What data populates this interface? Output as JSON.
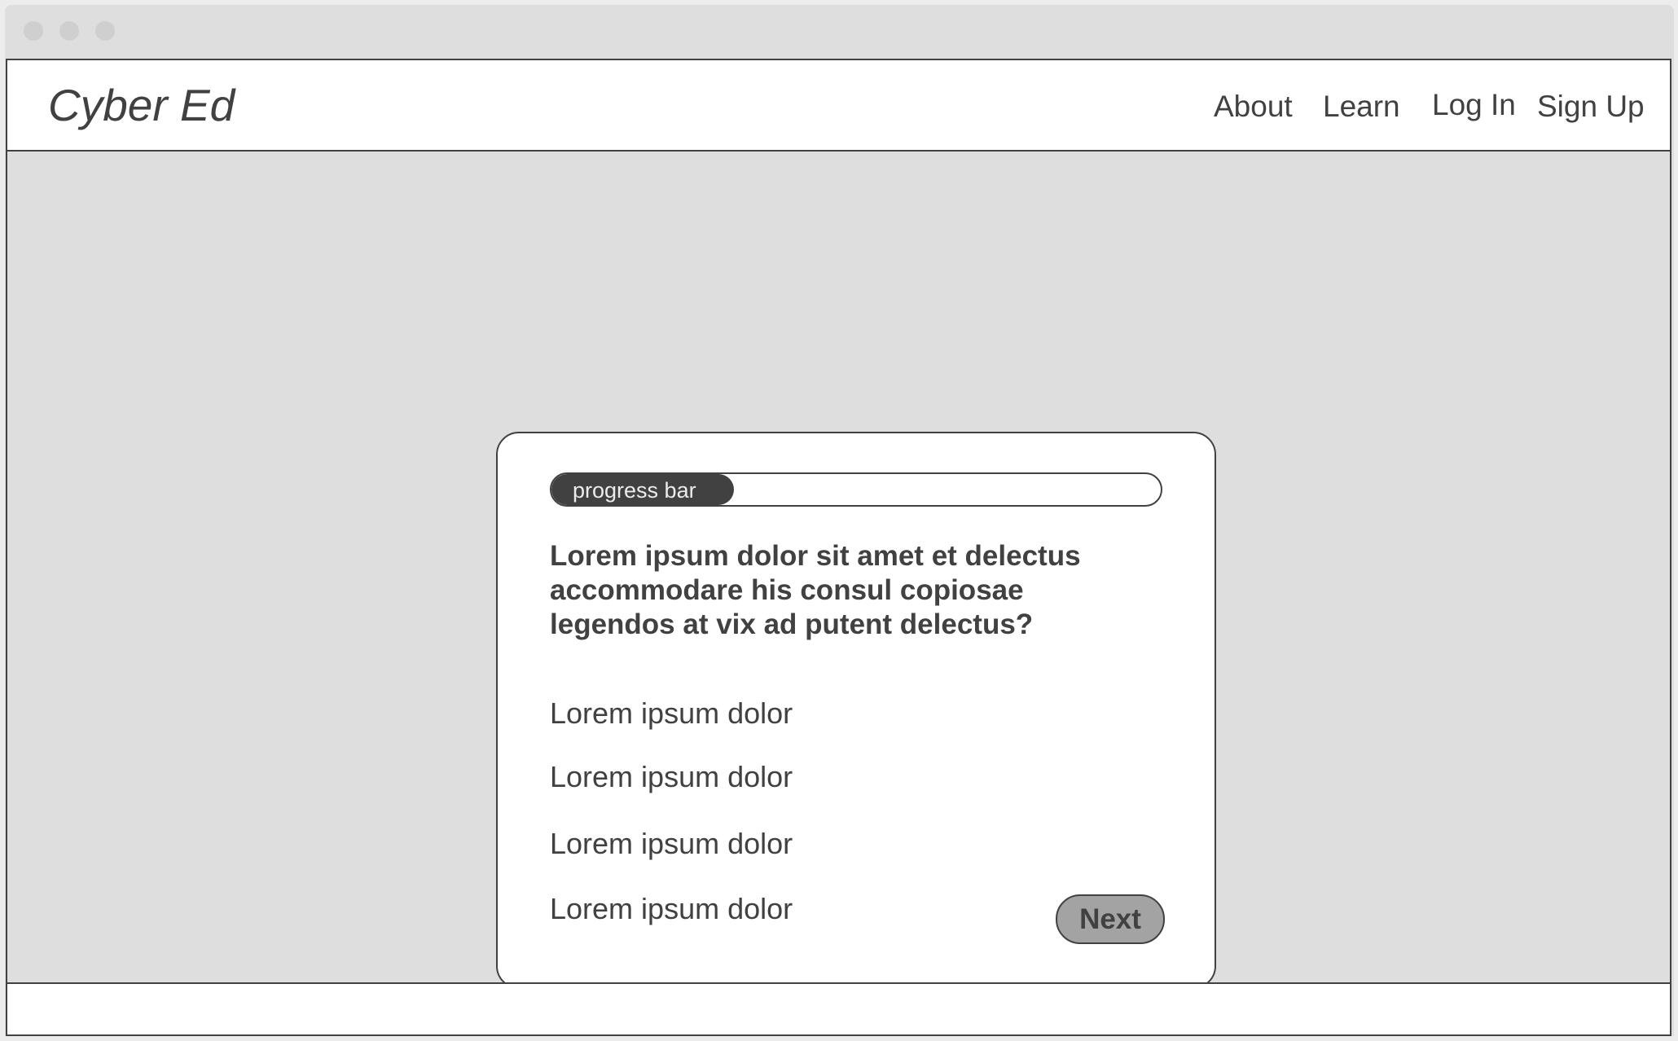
{
  "header": {
    "logo": "Cyber Ed",
    "nav": {
      "about": "About",
      "learn": "Learn",
      "login": "Log In",
      "signup": "Sign Up"
    }
  },
  "quiz": {
    "progress": {
      "label": "progress bar",
      "percent": 30
    },
    "question": "Lorem ipsum dolor sit amet et delectus accommodare his consul copiosae legendos at vix ad putent delectus?",
    "options": [
      "Lorem ipsum dolor",
      "Lorem ipsum dolor",
      "Lorem ipsum dolor",
      "Lorem ipsum dolor"
    ],
    "next_label": "Next"
  },
  "colors": {
    "text": "#414141",
    "background": "#dedede",
    "button": "#a3a3a3",
    "progress_fill": "#414141"
  }
}
